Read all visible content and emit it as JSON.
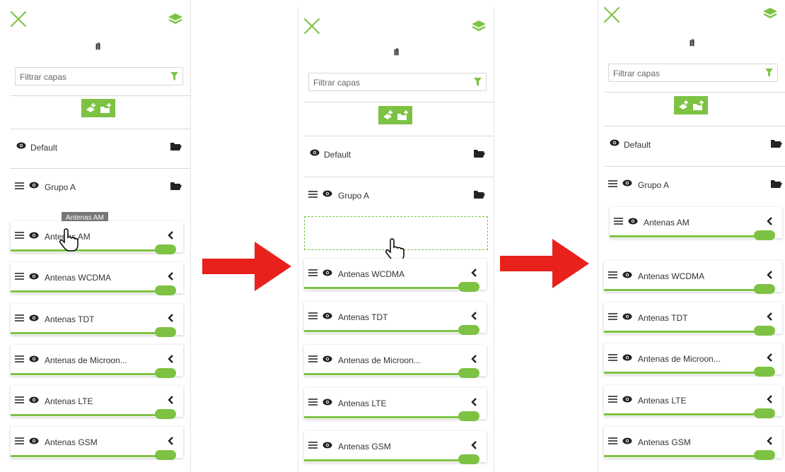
{
  "colors": {
    "accent": "#7dc243",
    "arrow": "#e8211c",
    "text": "#333333"
  },
  "icons": {
    "close": "close-x-icon",
    "layers": "layers-icon",
    "map": "map-icon",
    "filter": "filter-icon",
    "add_layer": "add-layer-icon",
    "add_folder": "add-folder-icon",
    "visibility": "eye-icon",
    "folder": "folder-open-icon",
    "drag": "drag-handle-icon",
    "collapse": "chevron-left-icon",
    "cursor": "hand-cursor-icon"
  },
  "panel": {
    "map_glyph": "Ⅲ̊",
    "filter_placeholder": "Filtrar capas",
    "groups": {
      "default": "Default",
      "group_a": "Grupo A"
    },
    "layers": [
      "Antenas AM",
      "Antenas WCDMA",
      "Antenas TDT",
      "Antenas de Microon...",
      "Antenas LTE",
      "Antenas GSM"
    ],
    "tooltip": "Antenas AM",
    "opacity": 1
  }
}
